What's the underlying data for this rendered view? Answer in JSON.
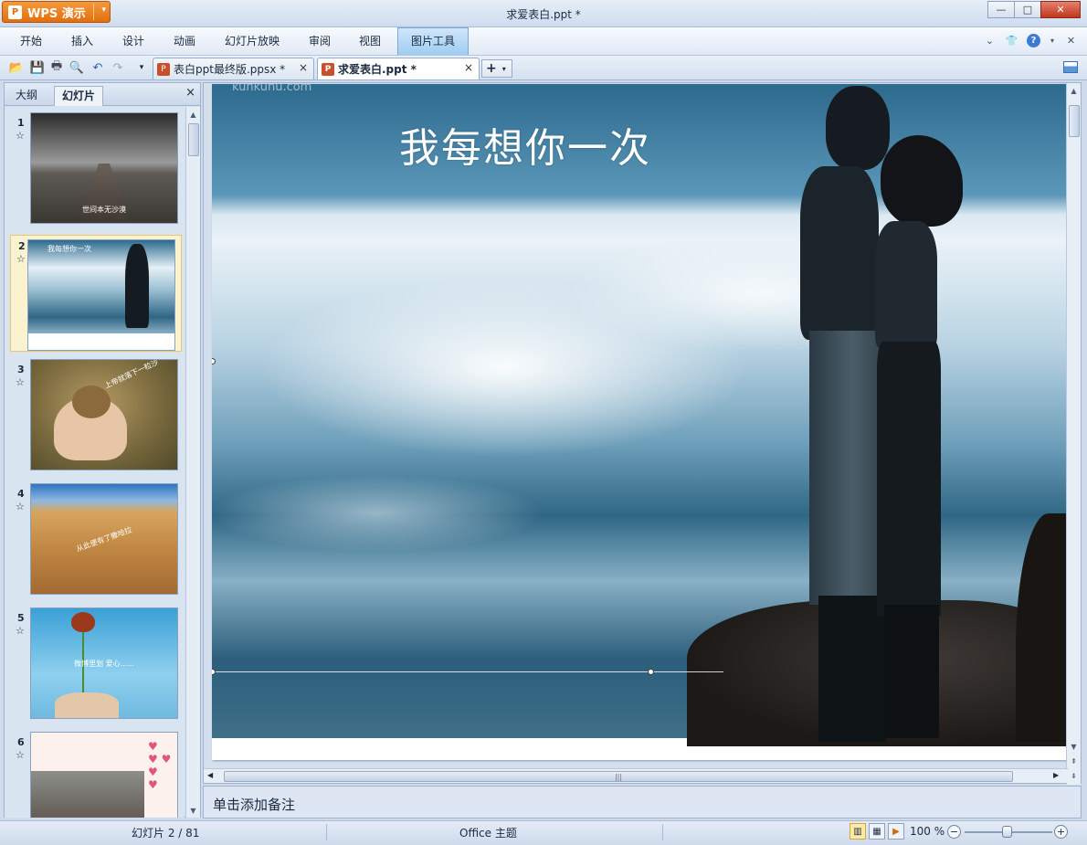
{
  "app": {
    "button_label": "WPS 演示",
    "logo_glyph": "P",
    "window_title": "求爱表白.ppt *"
  },
  "window_controls": {
    "minimize": "—",
    "maximize": "□",
    "close": "✕"
  },
  "menu": {
    "items": [
      "开始",
      "插入",
      "设计",
      "动画",
      "幻灯片放映",
      "审阅",
      "视图",
      "图片工具"
    ],
    "active_index": 7
  },
  "doc_tabs": [
    {
      "label": "表白ppt最终版.ppsx *",
      "close": "×",
      "active": false
    },
    {
      "label": "求爱表白.ppt *",
      "close": "×",
      "active": true
    }
  ],
  "new_tab": {
    "plus": "+",
    "dropdown": "▾"
  },
  "left_panel": {
    "tabs": [
      "大纲",
      "幻灯片"
    ],
    "active_tab": "幻灯片",
    "close": "×",
    "slides": [
      {
        "number": "1",
        "caption": "世间本无沙漠",
        "selected": false
      },
      {
        "number": "2",
        "caption": "我每想你一次",
        "selected": true
      },
      {
        "number": "3",
        "caption": "上帝就落下一粒沙",
        "selected": false
      },
      {
        "number": "4",
        "caption": "从此便有了撒哈拉",
        "selected": false
      },
      {
        "number": "5",
        "caption": "微博里划 爱心......",
        "selected": false
      },
      {
        "number": "6",
        "caption": "",
        "selected": false
      }
    ],
    "star_glyph": "☆"
  },
  "slide": {
    "title": "我每想你一次",
    "watermark": "kunkunu.com"
  },
  "notes": {
    "placeholder": "单击添加备注"
  },
  "status": {
    "slide_position": "幻灯片 2 / 81",
    "theme": "Office 主题",
    "zoom": "100 %",
    "zoom_level": 1.0
  },
  "colors": {
    "app_button": "#e2700f",
    "active_menu": "#9fcdf2",
    "selected_thumb": "#fbf3d0"
  }
}
